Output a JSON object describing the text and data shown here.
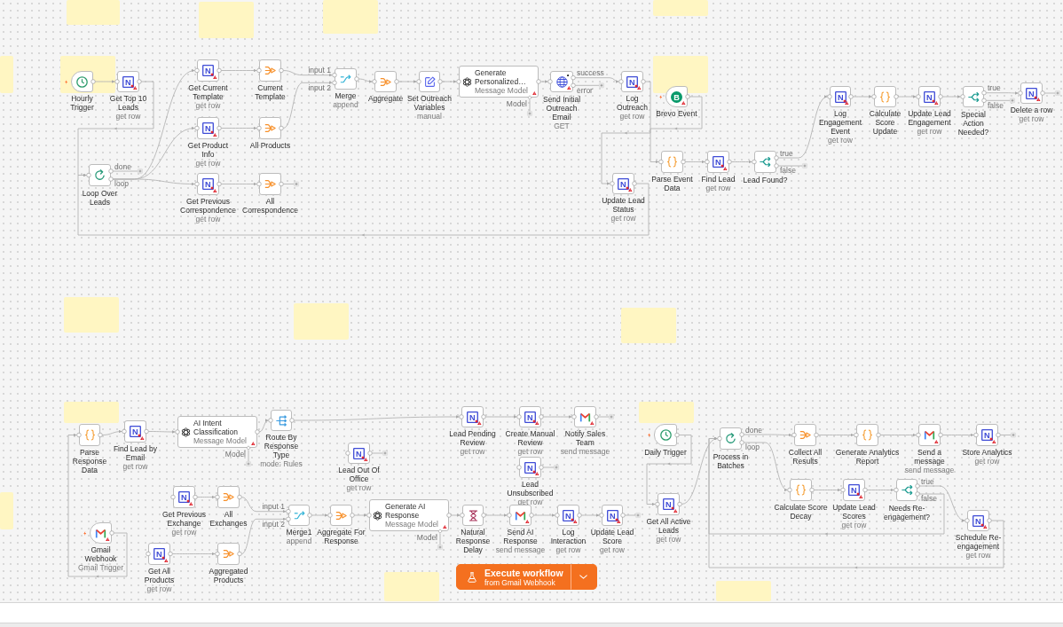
{
  "canvas": {
    "nodes": [
      {
        "label": "Hourly Trigger",
        "kind": "clock",
        "trigger": true,
        "issues": false,
        "pinned": false
      },
      {
        "label": "Get Top 10 Leads",
        "subtitle": "get row",
        "kind": "nocodb",
        "glyph": "N",
        "trigger": false,
        "issues": true,
        "pinned": false
      },
      {
        "label": "Get Current Template",
        "subtitle": "get row",
        "kind": "nocodb",
        "glyph": "N",
        "trigger": false,
        "issues": true,
        "pinned": false
      },
      {
        "label": "Current Template",
        "kind": "aggregate",
        "trigger": false,
        "issues": false,
        "pinned": false
      },
      {
        "label": "Get Product Info",
        "subtitle": "get row",
        "kind": "nocodb",
        "glyph": "N",
        "trigger": false,
        "issues": true,
        "pinned": false
      },
      {
        "label": "All Products",
        "kind": "aggregate",
        "trigger": false,
        "issues": false,
        "pinned": false
      },
      {
        "label": "Loop Over Leads",
        "kind": "loop",
        "outputs": [
          "done",
          "loop"
        ],
        "trigger": false,
        "issues": false,
        "pinned": false
      },
      {
        "label": "Get Previous Correspondence",
        "subtitle": "get row",
        "kind": "nocodb",
        "glyph": "N",
        "trigger": false,
        "issues": true,
        "pinned": false
      },
      {
        "label": "All Correspondence",
        "kind": "aggregate",
        "trigger": false,
        "issues": false,
        "pinned": false
      },
      {
        "label": "Merge",
        "subtitle": "append",
        "kind": "merge",
        "inputs": [
          "input 1",
          "input 2"
        ],
        "trigger": false,
        "issues": false,
        "pinned": false
      },
      {
        "label": "Aggregate",
        "kind": "aggregate",
        "trigger": false,
        "issues": false,
        "pinned": false
      },
      {
        "label": "Set Outreach Variables",
        "subtitle": "manual",
        "kind": "set",
        "trigger": false,
        "issues": false,
        "pinned": false
      },
      {
        "label": "Generate Personalized…",
        "subtitle": "Message Model",
        "kind": "ai",
        "sub_port": "Model",
        "trigger": false,
        "issues": true,
        "pinned": false
      },
      {
        "label": "Send Initial Outreach Email",
        "subtitle": "GET",
        "kind": "http",
        "outputs": [
          "success",
          "error"
        ],
        "trigger": false,
        "issues": true,
        "pinned": true
      },
      {
        "label": "Log Outreach",
        "subtitle": "get row",
        "kind": "nocodb",
        "glyph": "N",
        "trigger": false,
        "issues": true,
        "pinned": false
      },
      {
        "label": "Update Lead Status",
        "subtitle": "get row",
        "kind": "nocodb",
        "glyph": "N",
        "trigger": false,
        "issues": true,
        "pinned": false
      },
      {
        "label": "Brevo Event",
        "kind": "brevo",
        "glyph": "B",
        "trigger": true,
        "issues": true,
        "pinned": false
      },
      {
        "label": "Parse Event Data",
        "kind": "code",
        "trigger": false,
        "issues": false,
        "pinned": false
      },
      {
        "label": "Find Lead",
        "subtitle": "get row",
        "kind": "nocodb",
        "glyph": "N",
        "trigger": false,
        "issues": true,
        "pinned": false
      },
      {
        "label": "Lead Found?",
        "kind": "if",
        "outputs": [
          "true",
          "false"
        ],
        "trigger": false,
        "issues": false,
        "pinned": false
      },
      {
        "label": "Log Engagement Event",
        "subtitle": "get row",
        "kind": "nocodb",
        "glyph": "N",
        "trigger": false,
        "issues": true,
        "pinned": false
      },
      {
        "label": "Calculate Score Update",
        "kind": "code",
        "trigger": false,
        "issues": false,
        "pinned": false
      },
      {
        "label": "Update Lead Engagement",
        "subtitle": "get row",
        "kind": "nocodb",
        "glyph": "N",
        "trigger": false,
        "issues": true,
        "pinned": false
      },
      {
        "label": "Special Action Needed?",
        "kind": "if",
        "outputs": [
          "true",
          "false"
        ],
        "trigger": false,
        "issues": false,
        "pinned": false
      },
      {
        "label": "Delete a row",
        "subtitle": "get row",
        "kind": "nocodb",
        "glyph": "N",
        "trigger": false,
        "issues": true,
        "pinned": false
      },
      {
        "label": "Parse Response Data",
        "kind": "code",
        "trigger": false,
        "issues": false,
        "pinned": false
      },
      {
        "label": "Find Lead by Email",
        "subtitle": "get row",
        "kind": "nocodb",
        "glyph": "N",
        "trigger": false,
        "issues": true,
        "pinned": false
      },
      {
        "label": "AI Intent Classification",
        "subtitle": "Message Model",
        "kind": "ai",
        "sub_port": "Model",
        "trigger": false,
        "issues": true,
        "pinned": false
      },
      {
        "label": "Route By Response Type",
        "subtitle": "mode: Rules",
        "kind": "switch",
        "trigger": false,
        "issues": false,
        "pinned": false
      },
      {
        "label": "Lead Pending Review",
        "subtitle": "get row",
        "kind": "nocodb",
        "glyph": "N",
        "trigger": false,
        "issues": true,
        "pinned": false
      },
      {
        "label": "Create Manual Review",
        "subtitle": "get row",
        "kind": "nocodb",
        "glyph": "N",
        "trigger": false,
        "issues": true,
        "pinned": false
      },
      {
        "label": "Notify Sales Team",
        "subtitle": "send message",
        "kind": "gmail",
        "trigger": false,
        "issues": true,
        "pinned": false
      },
      {
        "label": "Lead Out Of Office",
        "subtitle": "get row",
        "kind": "nocodb",
        "glyph": "N",
        "trigger": false,
        "issues": true,
        "pinned": false
      },
      {
        "label": "Lead Unsubscribed",
        "subtitle": "get row",
        "kind": "nocodb",
        "glyph": "N",
        "trigger": false,
        "issues": true,
        "pinned": false
      },
      {
        "label": "Get Previous Exchange",
        "subtitle": "get row",
        "kind": "nocodb",
        "glyph": "N",
        "trigger": false,
        "issues": true,
        "pinned": false
      },
      {
        "label": "All Exchanges",
        "kind": "aggregate",
        "trigger": false,
        "issues": false,
        "pinned": false
      },
      {
        "label": "Merge1",
        "subtitle": "append",
        "kind": "merge",
        "inputs": [
          "input 1",
          "input 2"
        ],
        "trigger": false,
        "issues": false,
        "pinned": false
      },
      {
        "label": "Aggregate For Response",
        "kind": "aggregate",
        "trigger": false,
        "issues": false,
        "pinned": false
      },
      {
        "label": "Generate AI Response",
        "subtitle": "Message Model",
        "kind": "ai",
        "sub_port": "Model",
        "trigger": false,
        "issues": true,
        "pinned": false
      },
      {
        "label": "Natural Response Delay",
        "kind": "wait",
        "trigger": false,
        "issues": false,
        "pinned": false
      },
      {
        "label": "Send AI Response",
        "subtitle": "send message",
        "kind": "gmail",
        "trigger": false,
        "issues": true,
        "pinned": false
      },
      {
        "label": "Log Interaction",
        "subtitle": "get row",
        "kind": "nocodb",
        "glyph": "N",
        "trigger": false,
        "issues": true,
        "pinned": false
      },
      {
        "label": "Update Lead Score",
        "subtitle": "get row",
        "kind": "nocodb",
        "glyph": "N",
        "trigger": false,
        "issues": true,
        "pinned": false
      },
      {
        "label": "Gmail Webhook",
        "subtitle": "Gmail Trigger",
        "kind": "gmail",
        "trigger": true,
        "issues": true,
        "pinned": false
      },
      {
        "label": "Get All Products",
        "subtitle": "get row",
        "kind": "nocodb",
        "glyph": "N",
        "trigger": false,
        "issues": true,
        "pinned": false
      },
      {
        "label": "Aggregated Products",
        "kind": "aggregate",
        "trigger": false,
        "issues": false,
        "pinned": false
      },
      {
        "label": "Daily Trigger",
        "kind": "clock",
        "trigger": true,
        "issues": false,
        "pinned": false
      },
      {
        "label": "Process in Batches",
        "kind": "loop",
        "outputs": [
          "done",
          "loop"
        ],
        "trigger": false,
        "issues": false,
        "pinned": false
      },
      {
        "label": "Collect All Results",
        "kind": "aggregate",
        "trigger": false,
        "issues": false,
        "pinned": false
      },
      {
        "label": "Generate Analytics Report",
        "kind": "code",
        "trigger": false,
        "issues": false,
        "pinned": false
      },
      {
        "label": "Send a message",
        "subtitle": "send message",
        "kind": "gmail",
        "trigger": false,
        "issues": true,
        "pinned": false
      },
      {
        "label": "Store Analytics",
        "subtitle": "get row",
        "kind": "nocodb",
        "glyph": "N",
        "trigger": false,
        "issues": true,
        "pinned": false
      },
      {
        "label": "Get All Active Leads",
        "subtitle": "get row",
        "kind": "nocodb",
        "glyph": "N",
        "trigger": false,
        "issues": true,
        "pinned": false
      },
      {
        "label": "Calculate Score Decay",
        "kind": "code",
        "trigger": false,
        "issues": false,
        "pinned": false
      },
      {
        "label": "Update Lead Scores",
        "subtitle": "get row",
        "kind": "nocodb",
        "glyph": "N",
        "trigger": false,
        "issues": true,
        "pinned": false
      },
      {
        "label": "Needs Re-engagement?",
        "kind": "if",
        "outputs": [
          "true",
          "false"
        ],
        "trigger": false,
        "issues": false,
        "pinned": false
      },
      {
        "label": "Schedule Re-engagement",
        "subtitle": "get row",
        "kind": "nocodb",
        "glyph": "N",
        "trigger": false,
        "issues": true,
        "pinned": false
      }
    ]
  },
  "execute_button": {
    "label": "Execute workflow",
    "sublabel": "from Gmail Webhook"
  }
}
